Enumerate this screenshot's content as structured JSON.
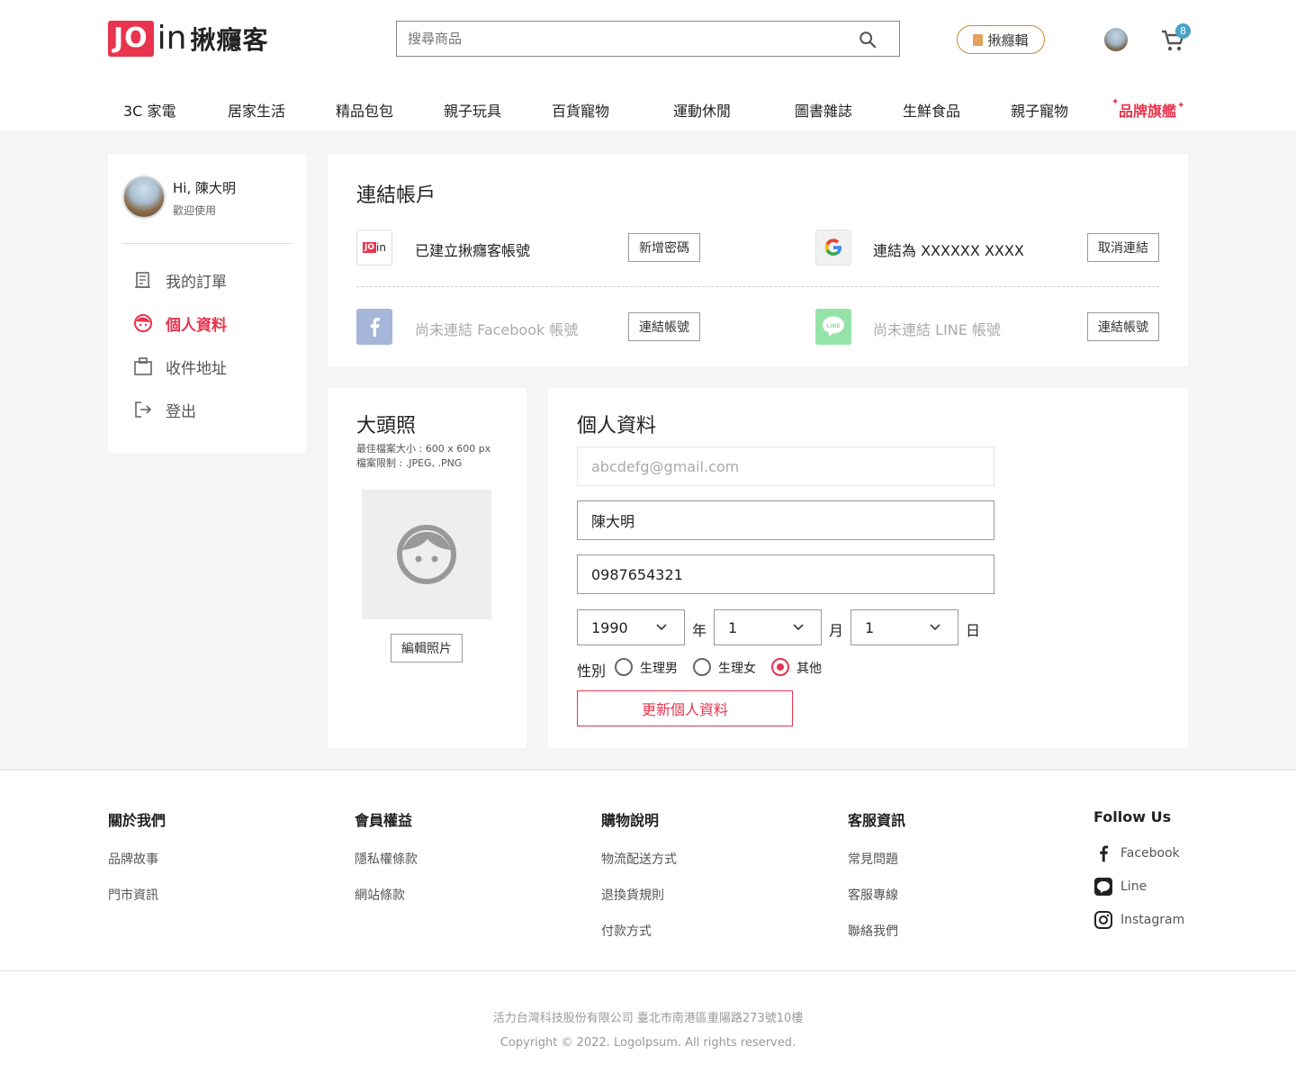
{
  "brand": {
    "logo_jo": "JO",
    "logo_in": "in",
    "logo_cn": "揪癮客"
  },
  "search": {
    "placeholder": "搜尋商品"
  },
  "header": {
    "magazine_label": "揪癮輯",
    "cart_count": "8"
  },
  "nav": {
    "items": [
      "3C 家電",
      "居家生活",
      "精品包包",
      "親子玩具",
      "百貨寵物",
      "運動休閒",
      "圖書雜誌",
      "生鮮食品",
      "親子寵物",
      "品牌旗艦"
    ]
  },
  "sidebar": {
    "greeting": "Hi, 陳大明",
    "welcome": "歡迎使用",
    "items": [
      {
        "label": "我的訂單",
        "icon": "receipt-icon",
        "active": false
      },
      {
        "label": "個人資料",
        "icon": "face-icon",
        "active": true
      },
      {
        "label": "收件地址",
        "icon": "clipboard-icon",
        "active": false
      },
      {
        "label": "登出",
        "icon": "logout-icon",
        "active": false
      }
    ]
  },
  "linked_accounts": {
    "title": "連結帳戶",
    "accounts": [
      {
        "icon": "join-logo-icon",
        "logo_text": "JOin",
        "text": "已建立揪癮客帳號",
        "button": "新增密碼",
        "linked": true
      },
      {
        "icon": "google-icon",
        "text": "連結為 XXXXXX XXXX",
        "button": "取消連結",
        "linked": true
      },
      {
        "icon": "facebook-icon",
        "text": "尚未連結 Facebook 帳號",
        "button": "連結帳號",
        "linked": false
      },
      {
        "icon": "line-icon",
        "logo_text": "LINE",
        "text": "尚未連結 LINE 帳號",
        "button": "連結帳號",
        "linked": false
      }
    ]
  },
  "photo": {
    "title": "大頭照",
    "size_note": "最佳檔案大小 : 600 x 600 px",
    "type_note": "檔案限制 : .JPEG, .PNG",
    "edit_button": "編輯照片"
  },
  "profile": {
    "title": "個人資料",
    "email": "abcdefg@gmail.com",
    "name": "陳大明",
    "phone": "0987654321",
    "birth_year": "1990",
    "birth_month": "1",
    "birth_day": "1",
    "year_unit": "年",
    "month_unit": "月",
    "day_unit": "日",
    "gender_label": "性別",
    "gender_options": [
      "生理男",
      "生理女",
      "其他"
    ],
    "gender_selected": "其他",
    "submit": "更新個人資料"
  },
  "footer": {
    "columns": [
      {
        "head": "關於我們",
        "links": [
          "品牌故事",
          "門市資訊"
        ]
      },
      {
        "head": "會員權益",
        "links": [
          "隱私權條款",
          "網站條款"
        ]
      },
      {
        "head": "購物說明",
        "links": [
          "物流配送方式",
          "退換貨規則",
          "付款方式"
        ]
      },
      {
        "head": "客服資訊",
        "links": [
          "常見問題",
          "客服專線",
          "聯絡我們"
        ]
      }
    ],
    "follow": {
      "head": "Follow Us",
      "items": [
        "Facebook",
        "Line",
        "Instagram"
      ]
    },
    "company": "活力台灣科技股份有限公司  臺北市南港區重陽路273號10樓",
    "copyright": "Copyright © 2022. LogoIpsum. All rights reserved."
  },
  "colors": {
    "accent": "#e8344e",
    "facebook": "#a6b6d8",
    "line": "#96e3a9",
    "badge": "#4aa1c8"
  }
}
